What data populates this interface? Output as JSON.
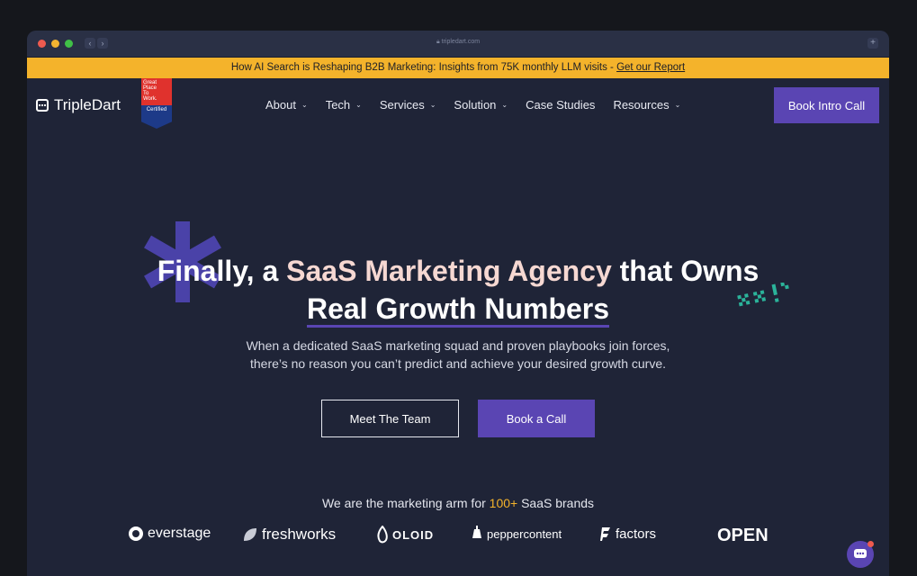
{
  "browser": {
    "url": "tripledart.com"
  },
  "announcement": {
    "text": "How AI Search is Reshaping B2B Marketing: Insights from 75K monthly LLM visits - ",
    "link": "Get our Report"
  },
  "header": {
    "logo_text": "TripleDart",
    "badge": {
      "line1": "Great",
      "line2": "Place",
      "line3": "To",
      "line4": "Work.",
      "certified": "Certified"
    },
    "nav": [
      {
        "label": "About",
        "has_dropdown": true
      },
      {
        "label": "Tech",
        "has_dropdown": true
      },
      {
        "label": "Services",
        "has_dropdown": true
      },
      {
        "label": "Solution",
        "has_dropdown": true
      },
      {
        "label": "Case Studies",
        "has_dropdown": false
      },
      {
        "label": "Resources",
        "has_dropdown": true
      }
    ],
    "cta_label": "Book Intro Call"
  },
  "hero": {
    "title_part1": "Finally, a ",
    "title_accent": "SaaS Marketing Agency",
    "title_part2": " that Owns",
    "title_line2": "Real Growth Numbers",
    "subtitle_line1": "When a dedicated SaaS marketing squad and proven playbooks join forces,",
    "subtitle_line2": "there’s no reason you can’t predict and achieve your desired growth curve.",
    "btn_team": "Meet The Team",
    "btn_call": "Book a Call"
  },
  "brands": {
    "heading_pre": "We are the marketing arm for ",
    "heading_count": "100+",
    "heading_post": " SaaS brands",
    "logos": [
      "everstage",
      "freshworks",
      "OLOID",
      "peppercontent",
      "factors",
      "OPEN"
    ]
  },
  "colors": {
    "accent": "#5a45b3",
    "banner": "#f4b32b",
    "background": "#1f2437"
  }
}
